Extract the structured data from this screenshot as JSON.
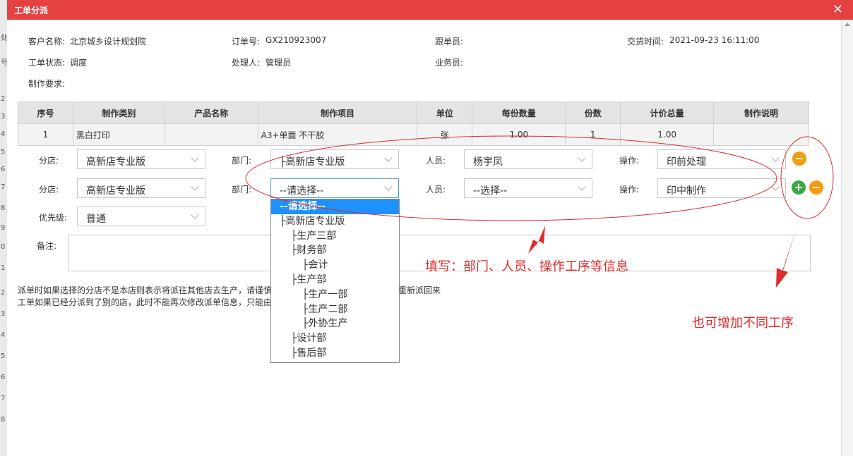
{
  "background": {
    "row_markers": [
      "号",
      "处",
      "2",
      "3",
      "4",
      "5",
      "6",
      "7",
      "8",
      "9",
      "0",
      "1",
      "2",
      "3",
      "4",
      "5",
      "6",
      "7",
      "8"
    ]
  },
  "dialog": {
    "title": "工单分派",
    "close": "✕"
  },
  "info": {
    "customer_label": "客户名称:",
    "customer": "北京城乡设计规划院",
    "order_label": "订单号:",
    "order": "GX210923007",
    "follower_label": "跟单员:",
    "delivery_label": "交货时间:",
    "delivery": "2021-09-23 16:11:00",
    "status_label": "工单状态:",
    "status": "调度",
    "handler_label": "处理人:",
    "handler": "管理员",
    "sales_label": "业务员:",
    "requirement_label": "制作要求:"
  },
  "table": {
    "headers": [
      "序号",
      "制作类别",
      "产品名称",
      "制作项目",
      "单位",
      "每份数量",
      "份数",
      "计价总量",
      "制作说明"
    ],
    "rows": [
      [
        "1",
        "黑白打印",
        "",
        "A3+单面 不干胶",
        "张",
        "1.00",
        "1",
        "1.00",
        ""
      ]
    ]
  },
  "form": {
    "branch_label": "分店:",
    "dept_label": "部门:",
    "person_label": "人员:",
    "op_label": "操作:",
    "priority_label": "优先级:",
    "remark_label": "备注:",
    "row1": {
      "branch": "高新店专业版",
      "dept": "├高新店专业版",
      "person": "杨宇凤",
      "op": "印前处理"
    },
    "row2": {
      "branch": "高新店专业版",
      "dept": "--请选择--",
      "person": "--选择--",
      "op": "印中制作"
    },
    "priority": "普通",
    "btn_minus": "−",
    "btn_plus": "+"
  },
  "dropdown": {
    "options": [
      "--请选择--",
      "├高新店专业版",
      "├生产三部",
      "├财务部",
      "├会计",
      "├生产部",
      "├生产一部",
      "├生产二部",
      "├外协生产",
      "├设计部",
      "├售后部"
    ]
  },
  "notes": {
    "line1a": "派单时如果选择的分店不是本店则表示将派往其他店去生产，请谨慎",
    "line1b": "员重新派回来",
    "line2": "工单如果已经分派到了别的店，此时不能再次修改派单信息，只能由"
  },
  "annotations": {
    "fill_info": "填写：部门、人员、操作工序等信息",
    "add_steps": "也可增加不同工序"
  },
  "colors": {
    "titlebar": "#e64141",
    "annotation": "#e02b2b",
    "selected_option": "#1e90ff",
    "minus": "#f39c12",
    "plus": "#3aa845"
  }
}
